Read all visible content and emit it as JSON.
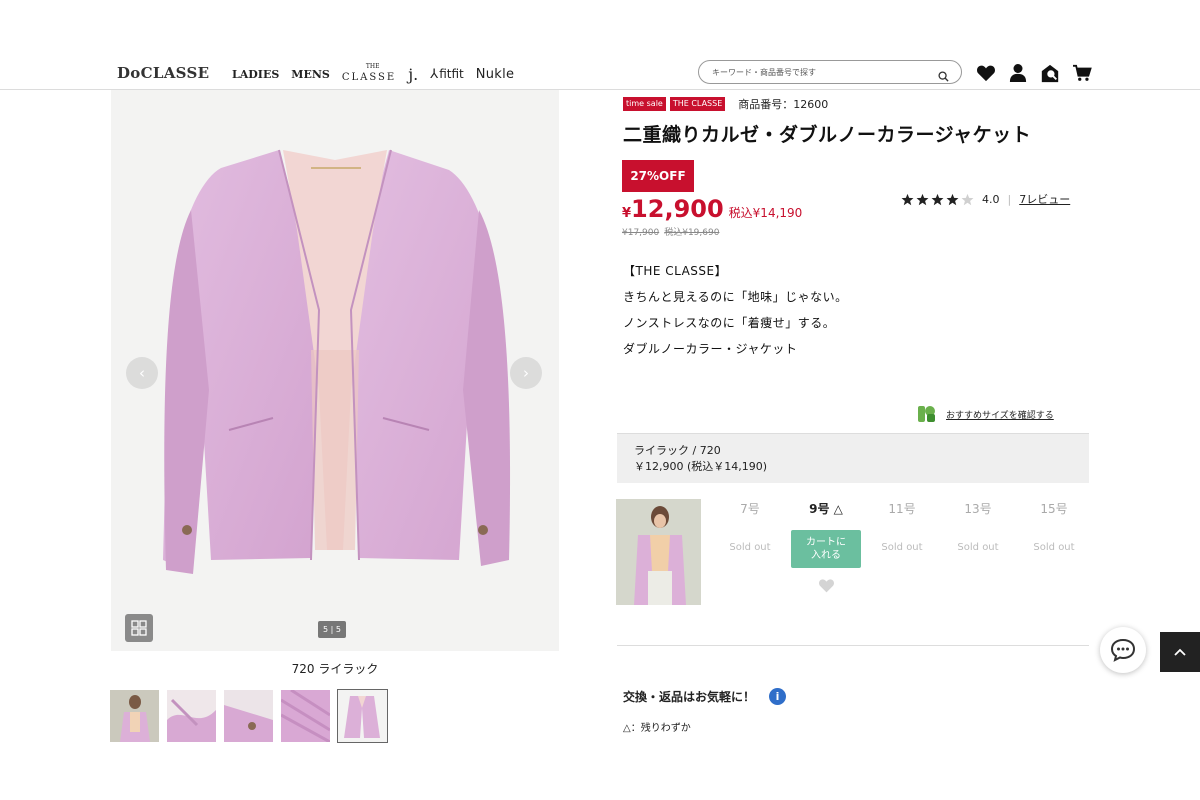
{
  "header": {
    "logo": "DoCLASSE",
    "nav": [
      "LADIES",
      "MENS",
      "CLASSE",
      "j.",
      "fitfit",
      "Nukle"
    ],
    "nav_classe_sup": "THE",
    "search_placeholder": "キーワード・商品番号で探す"
  },
  "product": {
    "badges": [
      "time sale",
      "THE CLASSE"
    ],
    "sku_label": "商品番号：12600",
    "title": "二重織りカルゼ・ダブルノーカラージャケット",
    "discount": "27%OFF",
    "price_yen": "¥",
    "price": "12,900",
    "price_tax": "税込¥14,190",
    "old_price": "¥17,900",
    "old_price_tax": "税込¥19,690",
    "rating_value": 4.0,
    "rating_text": "4.0",
    "reviews_link": "7レビュー",
    "description": [
      "【THE CLASSE】",
      "きちんと見えるのに「地味」じゃない。",
      "ノンストレスなのに「着痩せ」する。",
      "ダブルノーカラー・ジャケット"
    ],
    "size_check_link": "おすすめサイズを確認する"
  },
  "gallery": {
    "counter": "5 | 5",
    "caption": "720 ライラック"
  },
  "variant": {
    "color_line": "ライラック / 720",
    "price_line": "￥12,900 (税込￥14,190)",
    "sizes": [
      {
        "label": "7号",
        "status": "Sold out",
        "available": false
      },
      {
        "label": "9号 △",
        "status": "カートに入れる",
        "available": true
      },
      {
        "label": "11号",
        "status": "Sold out",
        "available": false
      },
      {
        "label": "13号",
        "status": "Sold out",
        "available": false
      },
      {
        "label": "15号",
        "status": "Sold out",
        "available": false
      }
    ],
    "cart_label_1": "カートに",
    "cart_label_2": "入れる"
  },
  "info": {
    "exchange": "交換・返品はお気軽に！",
    "info_icon": "i",
    "note": "△：残りわずか"
  },
  "colors": {
    "sale_red": "#c8102e",
    "cart_green": "#6bbf9f",
    "info_blue": "#2f6ec9",
    "jacket": "#dcb0d8"
  }
}
